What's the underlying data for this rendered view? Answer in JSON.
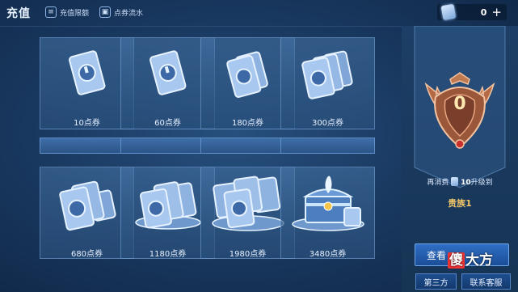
{
  "header": {
    "title": "充值",
    "links": [
      {
        "label": "充值限额",
        "icon": "recharge-limit-icon"
      },
      {
        "label": "点券流水",
        "icon": "voucher-flow-icon"
      }
    ],
    "currency": {
      "value": "0",
      "icon": "voucher-icon",
      "add_icon": "plus-icon"
    }
  },
  "products": [
    {
      "label": "10点券",
      "art": "voucher-1"
    },
    {
      "label": "60点券",
      "art": "voucher-1"
    },
    {
      "label": "180点券",
      "art": "voucher-2"
    },
    {
      "label": "300点券",
      "art": "voucher-3"
    },
    {
      "label": "680点券",
      "art": "voucher-stack"
    },
    {
      "label": "1180点券",
      "art": "voucher-pile"
    },
    {
      "label": "1980点券",
      "art": "voucher-big-pile"
    },
    {
      "label": "3480点券",
      "art": "voucher-chest"
    }
  ],
  "noble": {
    "level": "0",
    "upgrade_prefix": "再消费",
    "upgrade_amount": "10",
    "upgrade_suffix": "升级到",
    "next_level": "贵族1"
  },
  "buttons": {
    "view": "查看",
    "third_party": "第三方",
    "customer_service": "联系客服"
  },
  "watermark": {
    "highlight": "傻",
    "rest": "大方"
  },
  "colors": {
    "accent": "#2f6fc4",
    "gold": "#f0c56a",
    "bronze": "#b46a45"
  }
}
